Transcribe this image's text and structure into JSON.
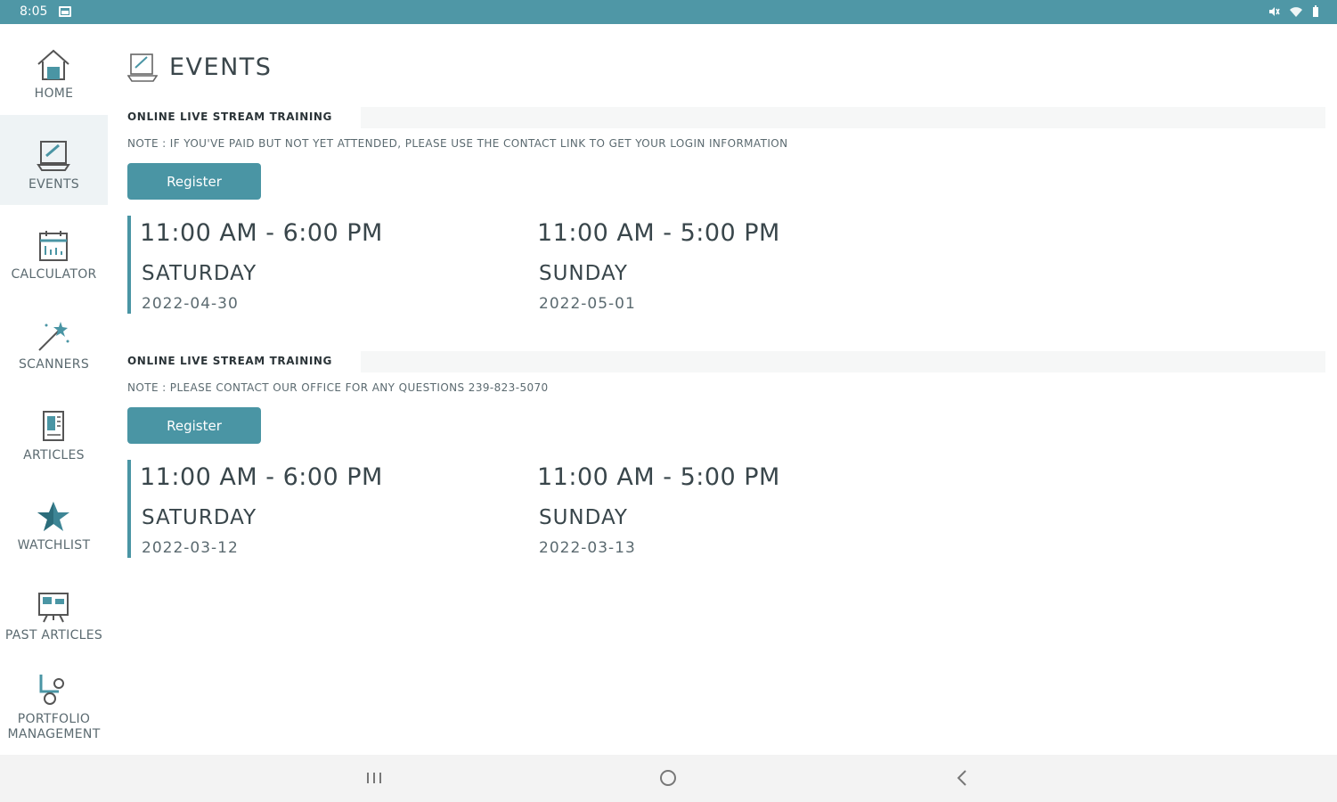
{
  "status_bar": {
    "time": "8:05",
    "right_icons": "mute-icon wifi-icon battery-icon"
  },
  "sidebar": {
    "items": [
      {
        "label": "HOME",
        "icon": "home-icon"
      },
      {
        "label": "EVENTS",
        "icon": "events-icon",
        "active": true
      },
      {
        "label": "CALCULATOR",
        "icon": "calculator-icon"
      },
      {
        "label": "SCANNERS",
        "icon": "magic-wand-icon"
      },
      {
        "label": "ARTICLES",
        "icon": "articles-icon"
      },
      {
        "label": "WATCHLIST",
        "icon": "star-icon"
      },
      {
        "label": "PAST ARTICLES",
        "icon": "presentation-icon"
      },
      {
        "label_line1": "PORTFOLIO",
        "label_line2": "MANAGEMENT",
        "icon": "portfolio-icon"
      }
    ]
  },
  "page": {
    "title": "EVENTS"
  },
  "events": [
    {
      "title": "ONLINE LIVE STREAM TRAINING",
      "note": "NOTE : IF YOU'VE PAID BUT NOT YET ATTENDED, PLEASE USE THE CONTACT LINK TO GET YOUR LOGIN INFORMATION",
      "button": "Register",
      "slots": [
        {
          "time": "11:00 AM - 6:00 PM",
          "day": "SATURDAY",
          "date": "2022-04-30"
        },
        {
          "time": "11:00 AM - 5:00 PM",
          "day": "SUNDAY",
          "date": "2022-05-01"
        }
      ]
    },
    {
      "title": "ONLINE LIVE STREAM TRAINING",
      "note": "NOTE : PLEASE CONTACT OUR OFFICE FOR ANY QUESTIONS 239-823-5070",
      "button": "Register",
      "slots": [
        {
          "time": "11:00 AM - 6:00 PM",
          "day": "SATURDAY",
          "date": "2022-03-12"
        },
        {
          "time": "11:00 AM - 5:00 PM",
          "day": "SUNDAY",
          "date": "2022-03-13"
        }
      ]
    }
  ],
  "colors": {
    "accent": "#4a95a4",
    "status_bar": "#4f97a6"
  }
}
